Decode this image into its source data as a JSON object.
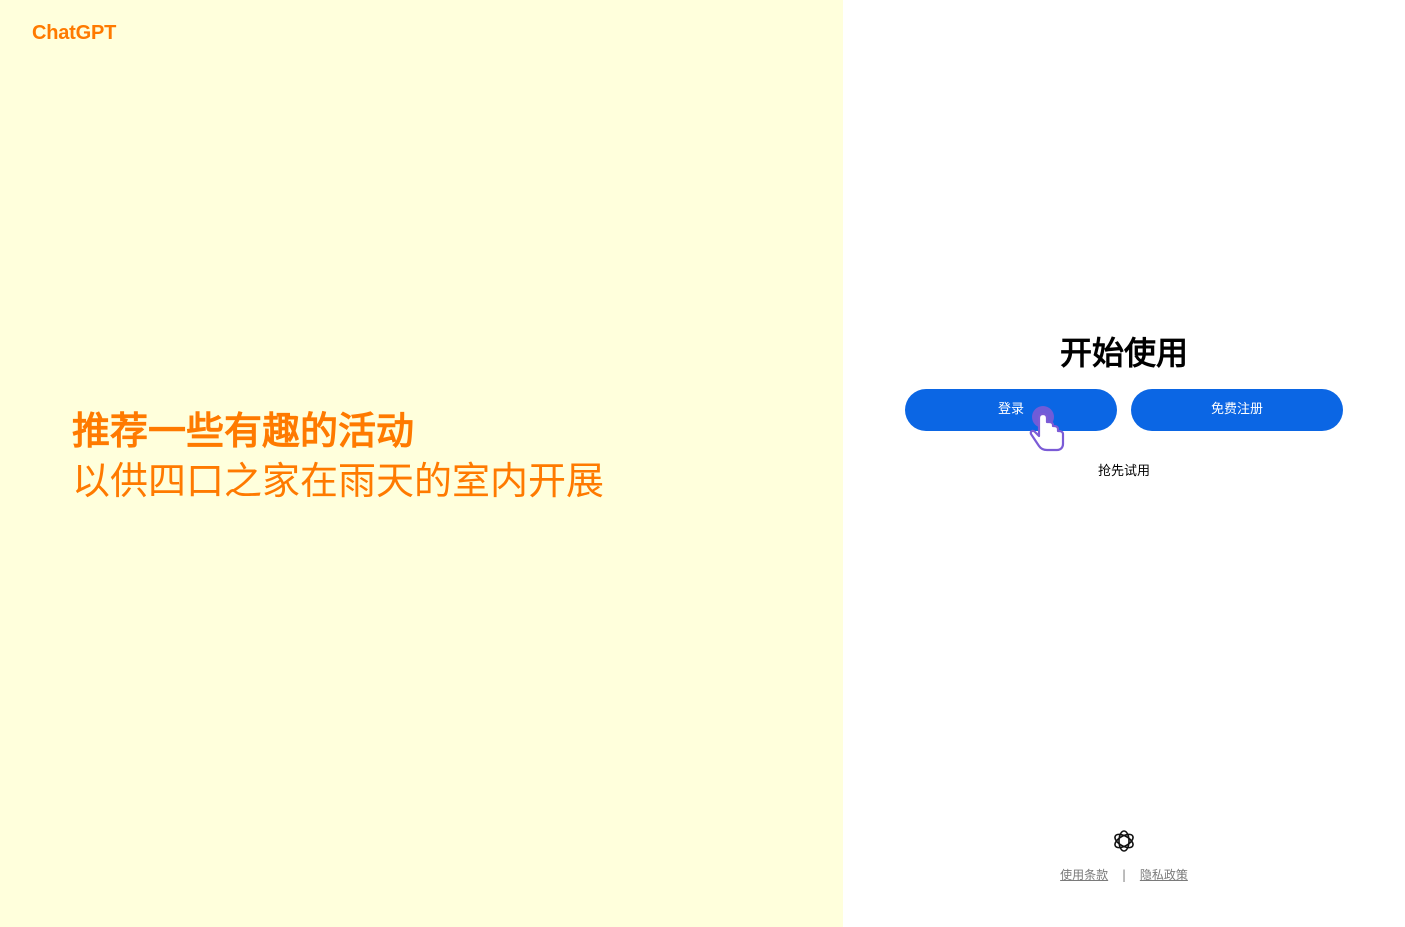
{
  "brand": {
    "logo_text": "ChatGPT"
  },
  "hero": {
    "line1": "推荐一些有趣的活动",
    "line2": "以供四口之家在雨天的室内开展"
  },
  "auth": {
    "title": "开始使用",
    "login_label": "登录",
    "signup_label": "免费注册",
    "trial_label": "抢先试用"
  },
  "footer": {
    "terms_label": "使用条款",
    "separator": "|",
    "privacy_label": "隐私政策"
  },
  "icons": {
    "cursor": "pointer-hand-icon",
    "footer_logo": "openai-logo-icon"
  },
  "colors": {
    "left_background": "#ffffdc",
    "accent_orange": "#ff7a00",
    "button_blue": "#0b66e4",
    "cursor_purple": "#7b5bd6"
  }
}
